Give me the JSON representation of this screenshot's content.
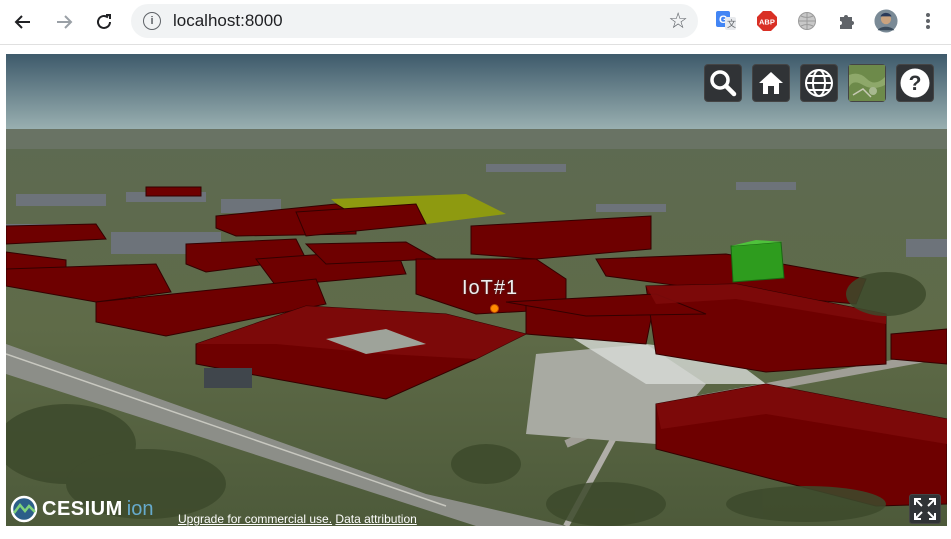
{
  "browser": {
    "url": "localhost:8000",
    "nav_icons": [
      "back-arrow-icon",
      "forward-arrow-icon",
      "reload-icon"
    ],
    "extensions": [
      "google-translate-icon",
      "adblock-plus-icon",
      "globe-extension-icon",
      "puzzle-extensions-icon",
      "profile-avatar",
      "menu-dots-icon"
    ],
    "abp_label": "ABP"
  },
  "viewer": {
    "toolbar": [
      "search-icon",
      "home-icon",
      "globe-icon",
      "base-layer-icon",
      "help-icon"
    ],
    "help_glyph": "?",
    "marker_label": "IoT#1",
    "credits": {
      "logo_text": "CESIUM",
      "logo_suffix": "ion",
      "upgrade": "Upgrade for commercial use.",
      "attribution": "Data attribution"
    }
  },
  "colors": {
    "buildings": "#6e0000",
    "highlight_building": "#2e9c1e",
    "highlight_lot": "#8e9a10",
    "marker": "#ff8c00",
    "toolbar_bg": "#303336"
  }
}
